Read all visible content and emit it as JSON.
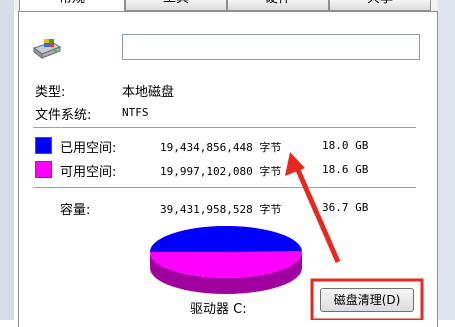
{
  "tabs": [
    "常规",
    "工具",
    "硬件",
    "共享"
  ],
  "drive": {
    "name_value": "",
    "type_label": "类型:",
    "type_value": "本地磁盘",
    "fs_label": "文件系统:",
    "fs_value": "NTFS"
  },
  "space": {
    "used_label": "已用空间:",
    "used_bytes": "19,434,856,448 字节",
    "used_human": "18.0 GB",
    "free_label": "可用空间:",
    "free_bytes": "19,997,102,080 字节",
    "free_human": "18.6 GB",
    "capacity_label": "容量:",
    "capacity_bytes": "39,431,958,528 字节",
    "capacity_human": "36.7 GB",
    "used_color": "#0000ff",
    "free_color": "#ff00ff",
    "used_fraction": 0.493
  },
  "drive_label": "驱动器 C:",
  "cleanup_button": "磁盘清理(D)"
}
